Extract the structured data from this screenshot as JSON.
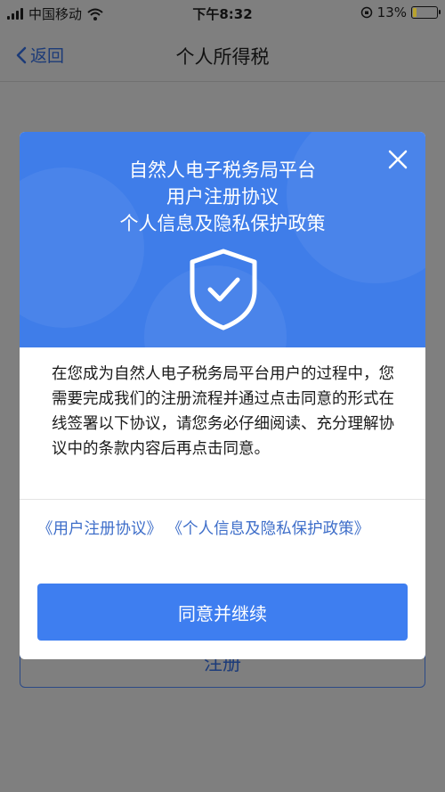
{
  "status_bar": {
    "carrier": "中国移动",
    "time": "下午8:32",
    "battery_percent": "13%",
    "battery_level": 0.13
  },
  "nav": {
    "back_label": "返回",
    "title": "个人所得税"
  },
  "background": {
    "register_label": "注册"
  },
  "modal": {
    "title_lines": [
      "自然人电子税务局平台",
      "用户注册协议",
      "个人信息及隐私保护政策"
    ],
    "body_text": "在您成为自然人电子税务局平台用户的过程中，您需要完成我们的注册流程并通过点击同意的形式在线签署以下协议，请您务必仔细阅读、充分理解协议中的条款内容后再点击同意。",
    "link_user_agreement": "《用户注册协议》",
    "link_privacy_policy": "《个人信息及隐私保护政策》",
    "agree_button": "同意并继续"
  },
  "colors": {
    "header_blue": "#3f7de9",
    "button_blue": "#3e7ef0",
    "link_blue": "#3e6ec9",
    "overlay_gray": "#7f7f7f"
  }
}
